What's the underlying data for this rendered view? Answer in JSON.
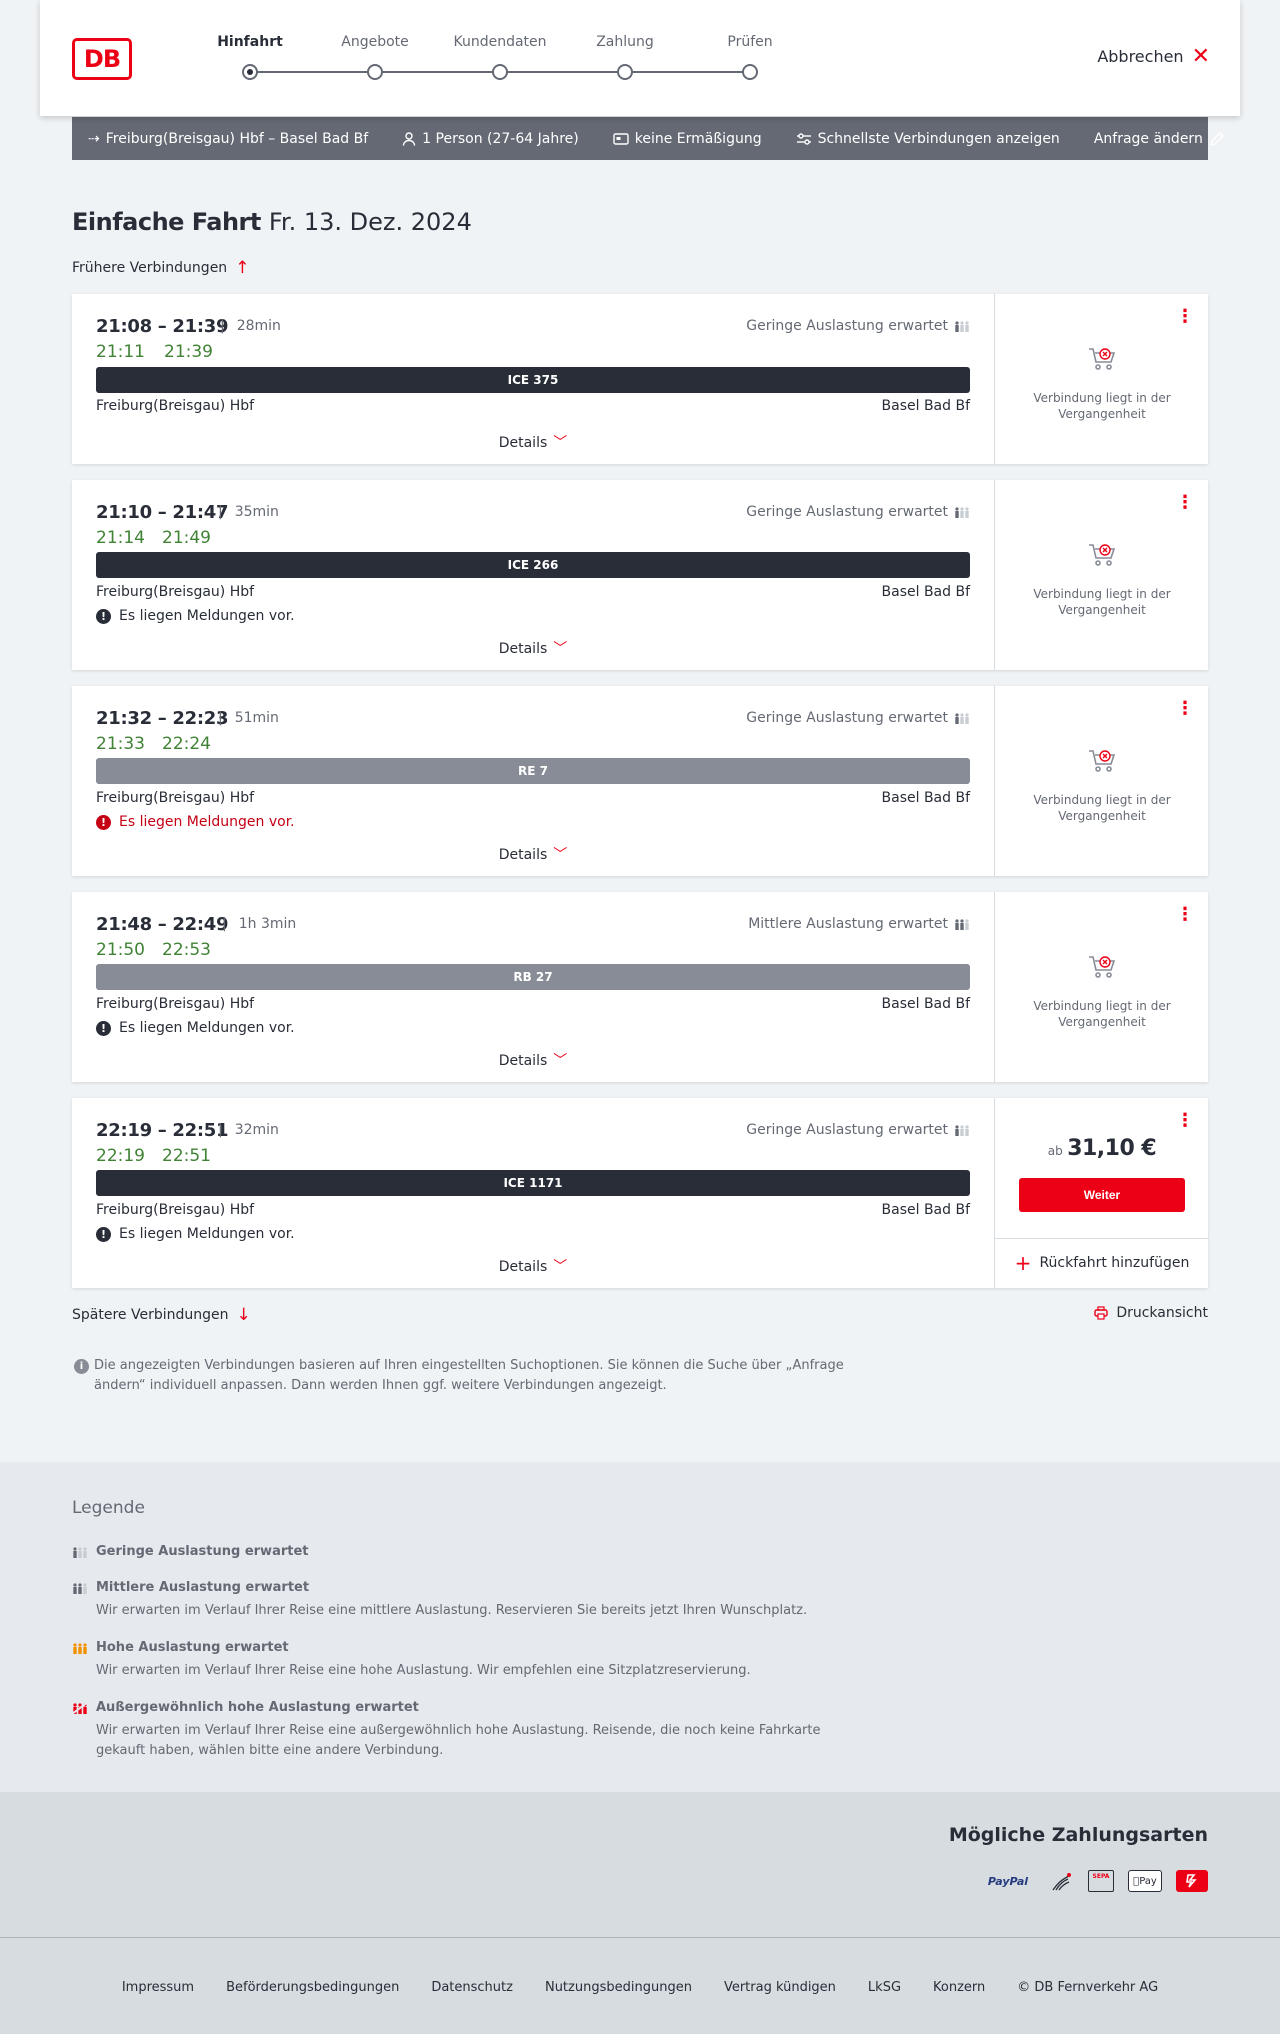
{
  "header": {
    "logo": "DB",
    "steps": [
      {
        "label": "Hinfahrt",
        "active": true
      },
      {
        "label": "Angebote",
        "active": false
      },
      {
        "label": "Kundendaten",
        "active": false
      },
      {
        "label": "Zahlung",
        "active": false
      },
      {
        "label": "Prüfen",
        "active": false
      }
    ],
    "cancel_label": "Abbrechen"
  },
  "summary": {
    "route": "Freiburg(Breisgau) Hbf – Basel Bad Bf",
    "passengers": "1 Person (27-64 Jahre)",
    "discount": "keine Ermäßigung",
    "filter": "Schnellste Verbindungen anzeigen",
    "edit": "Anfrage ändern"
  },
  "page": {
    "title": "Einfache Fahrt",
    "date": "Fr. 13. Dez. 2024",
    "earlier": "Frühere Verbindungen",
    "later": "Spätere Verbindungen",
    "print": "Druckansicht",
    "info": "Die angezeigten Verbindungen basieren auf Ihren eingestellten Suchoptionen. Sie können die Suche über „Anfrage ändern“ individuell anpassen. Dann werden Ihnen ggf. weitere Verbindungen angezeigt."
  },
  "connections": [
    {
      "times": "21:08 – 21:39",
      "duration": "28min",
      "rt_dep": "21:11",
      "rt_arr": "21:39",
      "occupancy": "Geringe Auslastung erwartet",
      "train": "ICE 375",
      "from": "Freiburg(Breisgau) Hbf",
      "to": "Basel Bad Bf",
      "message": "",
      "details": "Details",
      "status": "Verbindung liegt in der Vergangenheit"
    },
    {
      "times": "21:10 – 21:47",
      "duration": "35min",
      "rt_dep": "21:14",
      "rt_arr": "21:49",
      "occupancy": "Geringe Auslastung erwartet",
      "train": "ICE 266",
      "from": "Freiburg(Breisgau) Hbf",
      "to": "Basel Bad Bf",
      "message": "Es liegen Meldungen vor.",
      "details": "Details",
      "status": "Verbindung liegt in der Vergangenheit"
    },
    {
      "times": "21:32 – 22:23",
      "duration": "51min",
      "rt_dep": "21:33",
      "rt_arr": "22:24",
      "occupancy": "Geringe Auslastung erwartet",
      "train": "RE 7",
      "from": "Freiburg(Breisgau) Hbf",
      "to": "Basel Bad Bf",
      "message": "Es liegen Meldungen vor.",
      "details": "Details",
      "status": "Verbindung liegt in der Vergangenheit"
    },
    {
      "times": "21:48 – 22:49",
      "duration": "1h 3min",
      "rt_dep": "21:50",
      "rt_arr": "22:53",
      "occupancy": "Mittlere Auslastung erwartet",
      "train": "RB 27",
      "from": "Freiburg(Breisgau) Hbf",
      "to": "Basel Bad Bf",
      "message": "Es liegen Meldungen vor.",
      "details": "Details",
      "status": "Verbindung liegt in der Vergangenheit"
    },
    {
      "times": "22:19 – 22:51",
      "duration": "32min",
      "rt_dep": "22:19",
      "rt_arr": "22:51",
      "occupancy": "Geringe Auslastung erwartet",
      "train": "ICE 1171",
      "from": "Freiburg(Breisgau) Hbf",
      "to": "Basel Bad Bf",
      "message": "Es liegen Meldungen vor.",
      "details": "Details",
      "price_prefix": "ab",
      "price": "31,10 €",
      "button": "Weiter",
      "return": "Rückfahrt hinzufügen"
    }
  ],
  "legend": {
    "title": "Legende",
    "items": [
      {
        "title": "Geringe Auslastung erwartet",
        "desc": ""
      },
      {
        "title": "Mittlere Auslastung erwartet",
        "desc": "Wir erwarten im Verlauf Ihrer Reise eine mittlere Auslastung. Reservieren Sie bereits jetzt Ihren Wunschplatz."
      },
      {
        "title": "Hohe Auslastung erwartet",
        "desc": "Wir erwarten im Verlauf Ihrer Reise eine hohe Auslastung. Wir empfehlen eine Sitzplatzreservierung."
      },
      {
        "title": "Außergewöhnlich hohe Auslastung erwartet",
        "desc": "Wir erwarten im Verlauf Ihrer Reise eine außergewöhnlich hohe Auslastung. Reisende, die noch keine Fahrkarte gekauft haben, wählen bitte eine andere Verbindung."
      }
    ]
  },
  "payment": {
    "title": "Mögliche Zahlungsarten",
    "paypal": "PayPal",
    "sepa": "SEPA",
    "applepay": "Pay"
  },
  "footer": {
    "links": [
      "Impressum",
      "Beförderungsbedingungen",
      "Datenschutz",
      "Nutzungsbedingungen",
      "Vertrag kündigen",
      "LkSG",
      "Konzern"
    ],
    "copyright": "© DB Fernverkehr AG"
  },
  "colors": {
    "accent": "#ec0016",
    "realtime": "#408335",
    "dark": "#282d37",
    "summary_bg": "#646973"
  }
}
